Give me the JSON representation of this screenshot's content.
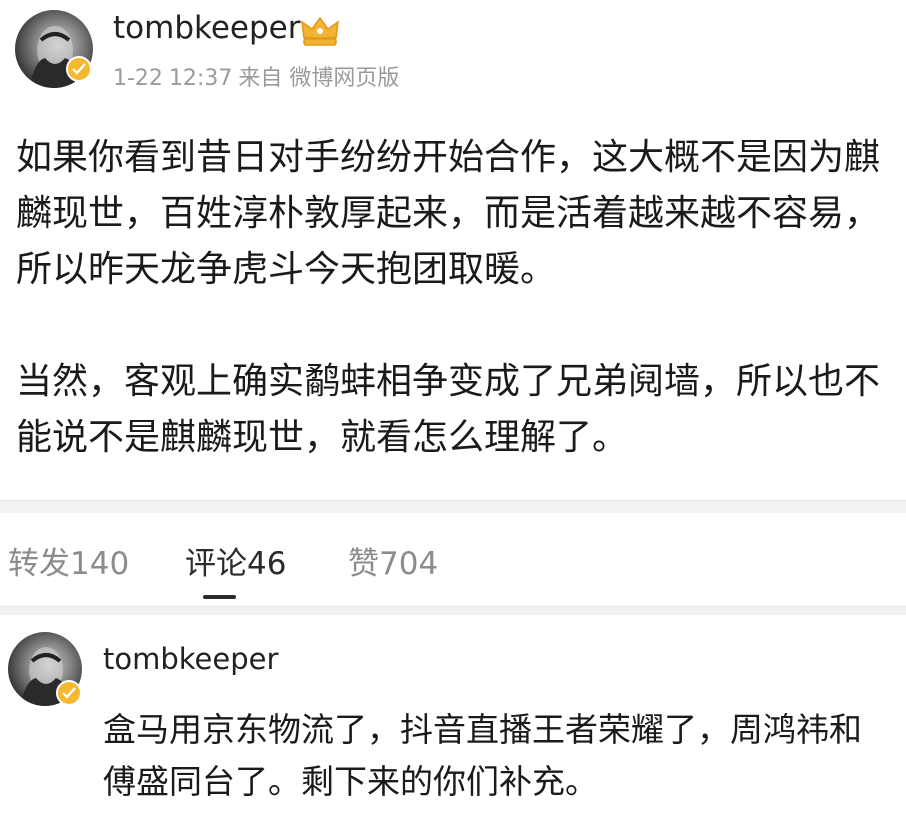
{
  "post": {
    "username": "tombkeeper",
    "date": "1-22",
    "time": "12:37",
    "source": "来自 微博网页版",
    "paragraphs": [
      "如果你看到昔日对手纷纷开始合作，这大概不是因为麒麟现世，百姓淳朴敦厚起来，而是活着越来越不容易，所以昨天龙争虎斗今天抱团取暖。",
      "当然，客观上确实鹬蚌相争变成了兄弟阋墙，所以也不能说不是麒麟现世，就看怎么理解了。"
    ]
  },
  "tabs": {
    "repost": "转发140",
    "comment": "评论46",
    "like": "赞704"
  },
  "comment": {
    "username": "tombkeeper",
    "text": "盒马用京东物流了，抖音直播王者荣耀了，周鸿祎和傅盛同台了。剩下来的你们补充。"
  },
  "colors": {
    "verified_badge": "#f5b82e",
    "muted_text": "#9a9a9a",
    "separator": "#f2f2f2"
  },
  "icons": [
    "avatar-image",
    "verified-badge-icon",
    "member-crown-icon"
  ]
}
